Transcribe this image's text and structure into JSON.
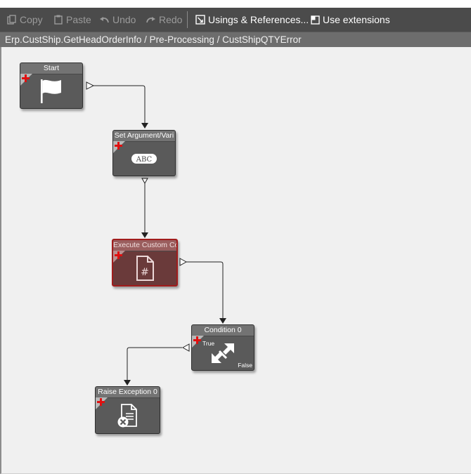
{
  "toolbar": {
    "copy": "Copy",
    "paste": "Paste",
    "undo": "Undo",
    "redo": "Redo",
    "usings": "Usings & References...",
    "extensions": "Use extensions"
  },
  "breadcrumb": "Erp.CustShip.GetHeadOrderInfo / Pre-Processing / CustShipQTYError",
  "nodes": {
    "start": {
      "title": "Start",
      "icon": "flag-icon"
    },
    "set_argument": {
      "title": "Set Argument/Vari",
      "icon": "abc-icon",
      "icon_text": "ABC"
    },
    "custom_code": {
      "title": "Execute Custom Co",
      "icon": "code-file-icon",
      "icon_text": "#"
    },
    "condition": {
      "title": "Condition 0",
      "icon": "condition-arrows-icon",
      "true_label": "True",
      "false_label": "False"
    },
    "raise_exception": {
      "title": "Raise Exception 0",
      "icon": "exception-document-icon"
    }
  },
  "colors": {
    "toolbar_bg": "#4b4b4b",
    "breadcrumb_bg": "#6d6d6d",
    "canvas_bg": "#f0f0f0",
    "node_bg": "#5a5a5a",
    "error_node_border": "#a11c1c",
    "add_marker": "#e01010"
  }
}
